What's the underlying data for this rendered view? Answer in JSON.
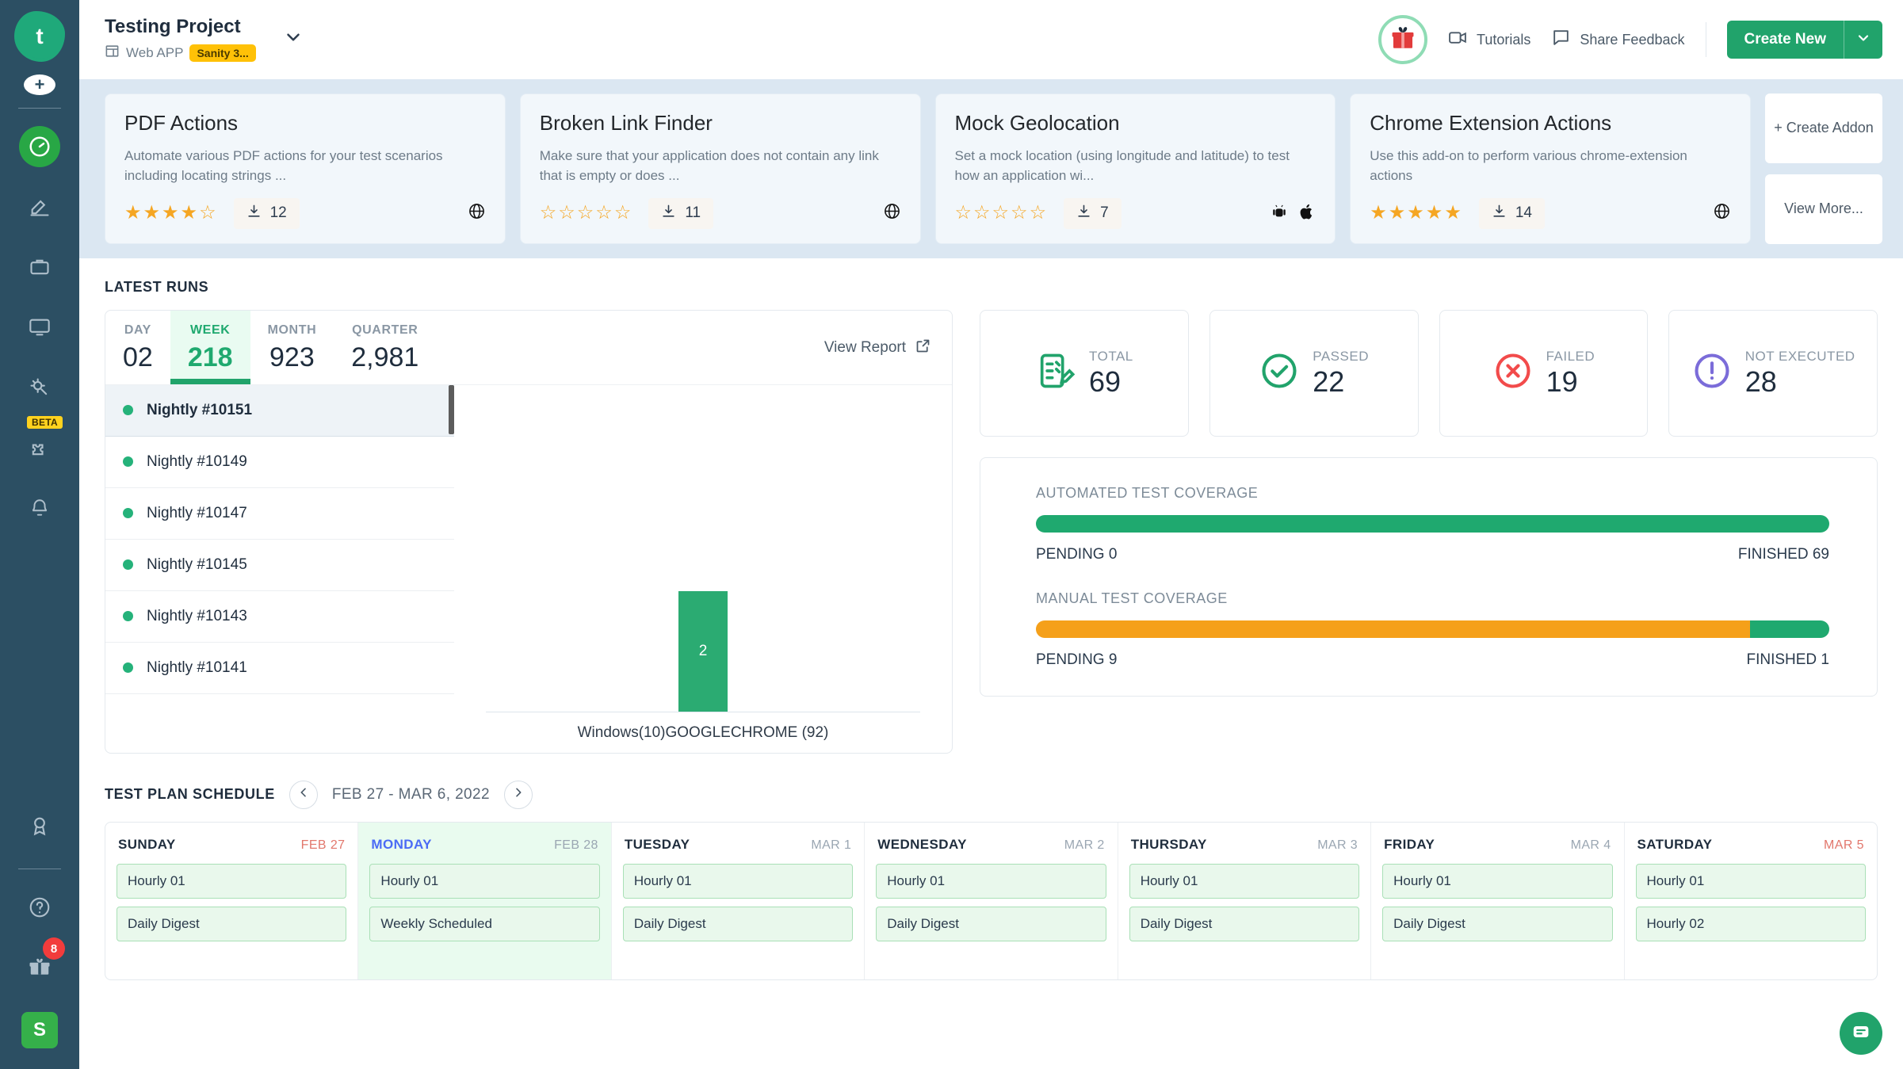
{
  "sidebar": {
    "logo": "t",
    "items": [
      {
        "name": "add",
        "icon": "plus-icon"
      },
      {
        "name": "dashboard",
        "icon": "speedometer-icon",
        "active": true
      },
      {
        "name": "authoring",
        "icon": "pencil-icon"
      },
      {
        "name": "projects",
        "icon": "briefcase-icon"
      },
      {
        "name": "devices",
        "icon": "monitor-icon"
      },
      {
        "name": "settings",
        "icon": "gear-wrench-icon"
      },
      {
        "name": "addons",
        "icon": "puzzle-icon",
        "badge": "BETA"
      },
      {
        "name": "notifications",
        "icon": "bell-icon"
      },
      {
        "name": "achievements",
        "icon": "award-icon"
      }
    ],
    "help_icon": "question-circle-icon",
    "gift_icon": "gift-icon",
    "gift_badge": "8",
    "avatar_label": "S"
  },
  "header": {
    "project_title": "Testing Project",
    "project_type": "Web APP",
    "project_type_icon": "window-icon",
    "chip": "Sanity 3...",
    "caret_icon": "chevron-down-icon",
    "gift_icon": "gift-box-icon",
    "tutorials_label": "Tutorials",
    "tutorials_icon": "video-icon",
    "feedback_label": "Share Feedback",
    "feedback_icon": "comment-icon",
    "create_label": "Create New",
    "create_caret_icon": "chevron-down-icon"
  },
  "addons": {
    "cards": [
      {
        "title": "PDF Actions",
        "desc": "Automate various PDF actions for your test scenarios including locating strings ...",
        "rating": 4,
        "downloads": "12",
        "platforms": [
          "globe-icon"
        ]
      },
      {
        "title": "Broken Link Finder",
        "desc": "Make sure that your application does not contain any link that is empty or does ...",
        "rating": 0,
        "downloads": "11",
        "platforms": [
          "globe-icon"
        ]
      },
      {
        "title": "Mock Geolocation",
        "desc": "Set a mock location (using longitude and latitude) to test how an application wi...",
        "rating": 0,
        "downloads": "7",
        "platforms": [
          "android-icon",
          "apple-icon"
        ]
      },
      {
        "title": "Chrome Extension Actions",
        "desc": "Use this add-on to perform various chrome-extension actions",
        "rating": 5,
        "downloads": "14",
        "platforms": [
          "globe-icon"
        ]
      }
    ],
    "create_addon_label": "+ Create Addon",
    "view_more_label": "View More..."
  },
  "latest_runs": {
    "section_title": "LATEST RUNS",
    "periods": [
      {
        "label": "DAY",
        "value": "02",
        "selected": false
      },
      {
        "label": "WEEK",
        "value": "218",
        "selected": true
      },
      {
        "label": "MONTH",
        "value": "923",
        "selected": false
      },
      {
        "label": "QUARTER",
        "value": "2,981",
        "selected": false
      }
    ],
    "view_report_label": "View Report",
    "view_report_icon": "external-link-icon",
    "runs": [
      {
        "label": "Nightly #10151",
        "status": "passed",
        "selected": true
      },
      {
        "label": "Nightly #10149",
        "status": "passed",
        "selected": false
      },
      {
        "label": "Nightly #10147",
        "status": "passed",
        "selected": false
      },
      {
        "label": "Nightly #10145",
        "status": "passed",
        "selected": false
      },
      {
        "label": "Nightly #10143",
        "status": "passed",
        "selected": false
      },
      {
        "label": "Nightly #10141",
        "status": "passed",
        "selected": false
      }
    ]
  },
  "chart_data": {
    "type": "bar",
    "title": "",
    "categories": [
      "Windows(10)GOOGLECHROME (92)"
    ],
    "values": [
      2
    ],
    "xlabel": "",
    "ylabel": "",
    "ylim": [
      0,
      2.3
    ],
    "grid": false,
    "legend": "none",
    "bar_color": "#2bab72",
    "data_labels": [
      "2"
    ]
  },
  "stats": [
    {
      "label": "TOTAL",
      "value": "69",
      "icon": "checklist-icon",
      "color": "#21a36b"
    },
    {
      "label": "PASSED",
      "value": "22",
      "icon": "check-circle-icon",
      "color": "#21a36b"
    },
    {
      "label": "FAILED",
      "value": "19",
      "icon": "x-circle-icon",
      "color": "#f24b4b"
    },
    {
      "label": "NOT EXECUTED",
      "value": "28",
      "icon": "exclamation-circle-icon",
      "color": "#7b6cd9"
    }
  ],
  "coverage": [
    {
      "label": "AUTOMATED TEST COVERAGE",
      "pending_label": "PENDING 0",
      "finished_label": "FINISHED 69",
      "pending_pct": 0,
      "finished_pct": 100,
      "pending_color": "#f5a01a",
      "finished_color": "#1fa96f"
    },
    {
      "label": "MANUAL TEST COVERAGE",
      "pending_label": "PENDING 9",
      "finished_label": "FINISHED 1",
      "pending_pct": 90,
      "finished_pct": 10,
      "pending_color": "#f5a01a",
      "finished_color": "#1fa96f"
    }
  ],
  "schedule": {
    "section_title": "TEST PLAN SCHEDULE",
    "prev_icon": "chevron-left-icon",
    "next_icon": "chevron-right-icon",
    "range": "FEB 27 - MAR 6, 2022",
    "days": [
      {
        "day": "SUNDAY",
        "date": "FEB 27",
        "weekend": true,
        "highlight": false,
        "events": [
          "Hourly 01",
          "Daily Digest"
        ]
      },
      {
        "day": "MONDAY",
        "date": "FEB 28",
        "weekend": false,
        "highlight": true,
        "events": [
          "Hourly 01",
          "Weekly Scheduled"
        ]
      },
      {
        "day": "TUESDAY",
        "date": "MAR 1",
        "weekend": false,
        "highlight": false,
        "events": [
          "Hourly 01",
          "Daily Digest"
        ]
      },
      {
        "day": "WEDNESDAY",
        "date": "MAR 2",
        "weekend": false,
        "highlight": false,
        "events": [
          "Hourly 01",
          "Daily Digest"
        ]
      },
      {
        "day": "THURSDAY",
        "date": "MAR 3",
        "weekend": false,
        "highlight": false,
        "events": [
          "Hourly 01",
          "Daily Digest"
        ]
      },
      {
        "day": "FRIDAY",
        "date": "MAR 4",
        "weekend": false,
        "highlight": false,
        "events": [
          "Hourly 01",
          "Daily Digest"
        ]
      },
      {
        "day": "SATURDAY",
        "date": "MAR 5",
        "weekend": true,
        "highlight": false,
        "events": [
          "Hourly 01",
          "Hourly 02"
        ]
      }
    ]
  },
  "chat": {
    "icon": "chat-bubble-icon"
  }
}
